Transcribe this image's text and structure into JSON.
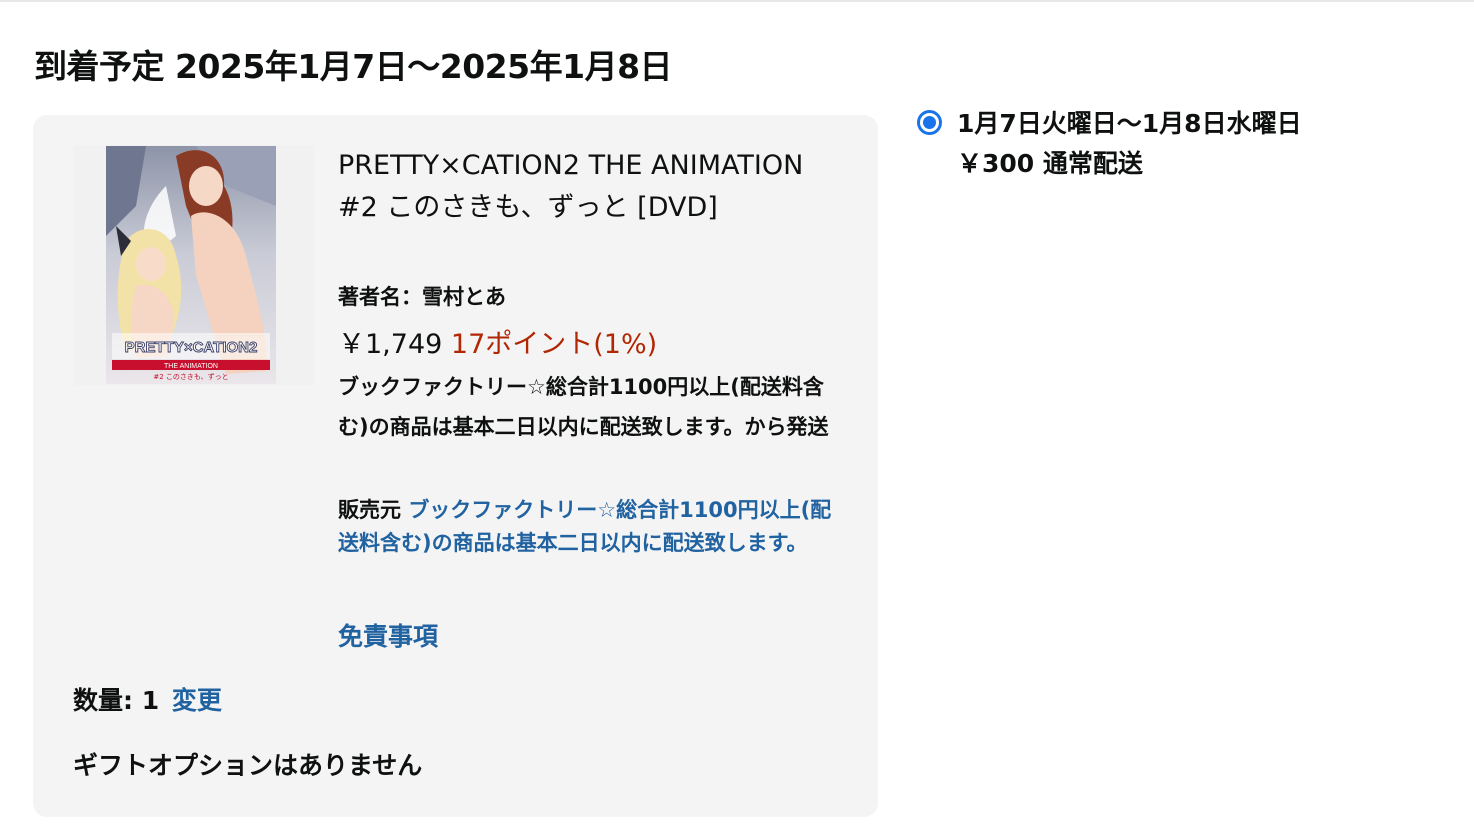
{
  "delivery": {
    "title": "到着予定 2025年1月7日〜2025年1月8日"
  },
  "item": {
    "image_alt": "PRETTY×CATION2 THE ANIMATION cover",
    "cover_logo": "PRETTY×CATION2",
    "cover_subtitle": "THE ANIMATION",
    "cover_caption": "#2 このさきも、ずっと",
    "title": "PRETTY×CATION2 THE ANIMATION #2 このさきも、ずっと [DVD]",
    "author": "著者名：雪村とあ",
    "price": "￥1,749",
    "points": "17ポイント(1%)",
    "ships_from": "ブックファクトリー☆総合計1100円以上(配送料含む)の商品は基本二日以内に配送致します。から発送",
    "seller_label": "販売元",
    "seller_name": "ブックファクトリー☆総合計1100円以上(配送料含む)の商品は基本二日以内に配送致します。",
    "disclaimer": "免責事項",
    "quantity_label": "数量: 1",
    "quantity_change": "変更",
    "gift_option": "ギフトオプションはありません"
  },
  "shipping_option": {
    "selected": true,
    "dates": "1月7日火曜日〜1月8日水曜日",
    "price_and_method": "￥300 通常配送"
  },
  "colors": {
    "link": "#2162a1",
    "points": "#b12704",
    "radio": "#1a73e8",
    "card_background": "#f4f4f4"
  }
}
